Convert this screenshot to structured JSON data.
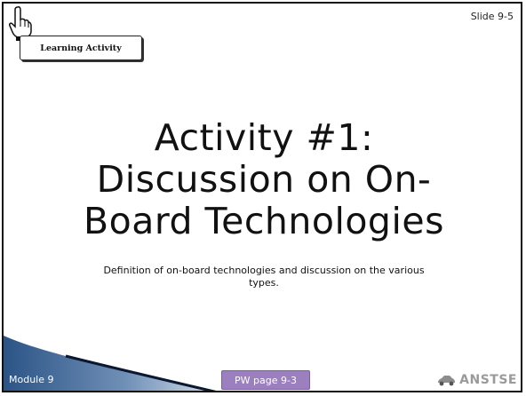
{
  "slide_number": "Slide 9-5",
  "badge": {
    "label": "Learning Activity",
    "icon": "pointing-hand-icon"
  },
  "title": {
    "line1": "Activity #1:",
    "line2": "Discussion on On-",
    "line3": "Board Technologies"
  },
  "subtitle": {
    "line1": "Definition of on-board technologies and discussion on the various",
    "line2": "types."
  },
  "footer": {
    "module": "Module 9",
    "pw_button": "PW page 9-3",
    "brand": "ANSTSE",
    "brand_icon": "car-logo-icon"
  },
  "colors": {
    "corner_gradient": "#1c3f6e",
    "button": "#9b7fbf",
    "brand_text": "#9a9a9a"
  }
}
